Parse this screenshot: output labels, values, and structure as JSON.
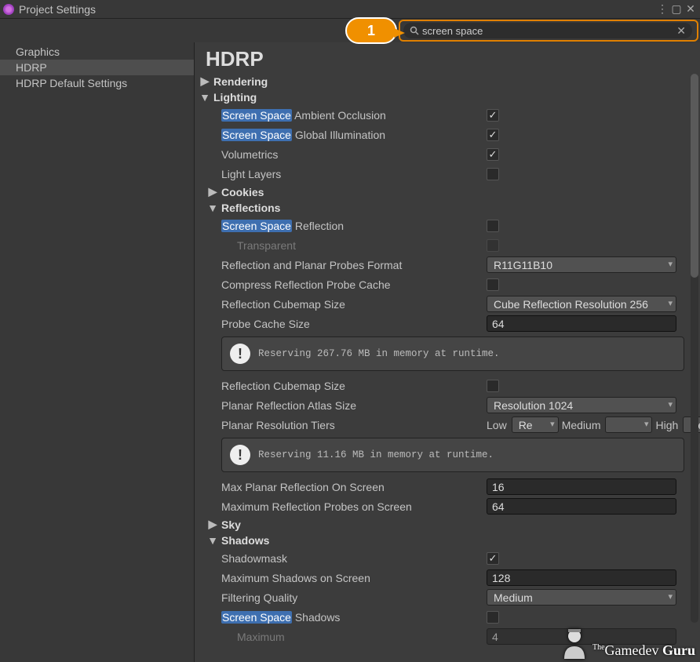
{
  "window": {
    "title": "Project Settings"
  },
  "callout_number": "1",
  "search": {
    "value": "screen space"
  },
  "sidebar": {
    "items": [
      {
        "label": "Graphics"
      },
      {
        "label": "HDRP"
      },
      {
        "label": "HDRP Default Settings"
      }
    ]
  },
  "panel": {
    "title": "HDRP",
    "rendering": "Rendering",
    "lighting": "Lighting",
    "cookies": "Cookies",
    "reflections": "Reflections",
    "sky": "Sky",
    "shadows": "Shadows",
    "hl": "Screen Space",
    "ss_ao": " Ambient Occlusion",
    "ss_gi": " Global Illumination",
    "volumetrics": "Volumetrics",
    "light_layers": "Light Layers",
    "ss_refl": " Reflection",
    "transparent": "Transparent",
    "refl_planar_format": "Reflection and Planar Probes Format",
    "refl_planar_format_val": "R11G11B10",
    "compress_cache": "Compress Reflection Probe Cache",
    "refl_cubemap": "Reflection Cubemap Size",
    "refl_cubemap_val": "Cube Reflection Resolution 256",
    "probe_cache": "Probe Cache Size",
    "probe_cache_val": "64",
    "info1": "Reserving 267.76 MB in memory at runtime.",
    "refl_cubemap2": "Reflection Cubemap Size",
    "planar_atlas": "Planar Reflection Atlas Size",
    "planar_atlas_val": "Resolution 1024",
    "planar_tiers": "Planar Resolution Tiers",
    "tiers": {
      "low": "Low",
      "low_v": "Re",
      "med": "Medium",
      "med_v": "",
      "high": "High",
      "high_v": "Re"
    },
    "info2": "Reserving 11.16 MB in memory at runtime.",
    "max_planar": "Max Planar Reflection On Screen",
    "max_planar_val": "16",
    "max_probes": "Maximum Reflection Probes on Screen",
    "max_probes_val": "64",
    "shadowmask": "Shadowmask",
    "max_shadows": "Maximum Shadows on Screen",
    "max_shadows_val": "128",
    "filter_quality": "Filtering Quality",
    "filter_quality_val": "Medium",
    "ss_shadows": " Shadows",
    "maximum_trunc": "Maximum",
    "maximum_trunc_val": "4"
  },
  "watermark": {
    "the": "The",
    "gd": "Gamedev",
    "guru": "Guru"
  }
}
